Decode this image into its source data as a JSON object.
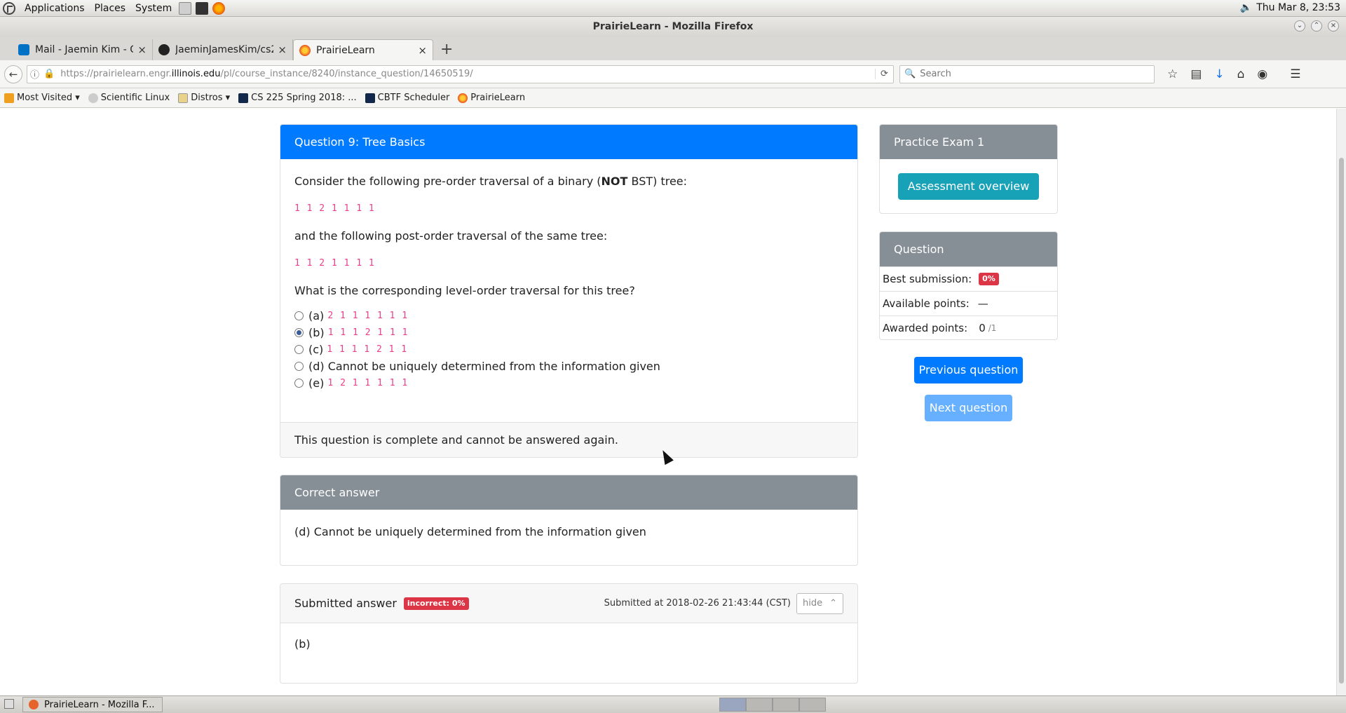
{
  "desktop": {
    "menus": [
      "Applications",
      "Places",
      "System"
    ],
    "clock": "Thu Mar  8, 23:53"
  },
  "window": {
    "title": "PrairieLearn - Mozilla Firefox"
  },
  "tabs": [
    {
      "label": "Mail - Jaemin Kim - O..."
    },
    {
      "label": "JaeminJamesKim/cs2..."
    },
    {
      "label": "PrairieLearn"
    }
  ],
  "url": {
    "prefix": "https://prairielearn.engr.",
    "domain": "illinois.edu",
    "path": "/pl/course_instance/8240/instance_question/14650519/"
  },
  "search": {
    "placeholder": "Search"
  },
  "bookmarks": [
    {
      "label": "Most Visited ▾"
    },
    {
      "label": "Scientific Linux"
    },
    {
      "label": "Distros ▾"
    },
    {
      "label": "CS 225 Spring 2018: ..."
    },
    {
      "label": "CBTF Scheduler"
    },
    {
      "label": "PrairieLearn"
    }
  ],
  "question": {
    "header": "Question 9: Tree Basics",
    "prompt_pre": "Consider the following pre-order traversal of a binary (",
    "prompt_bold": "NOT",
    "prompt_post": " BST) tree:",
    "preorder": "1 1 2 1 1 1 1",
    "prompt2": "and the following post-order traversal of the same tree:",
    "postorder": "1 1 2 1 1 1 1",
    "prompt3": "What is the corresponding level-order traversal for this tree?",
    "options": [
      {
        "key": "(a)",
        "text": "2 1 1 1 1 1 1",
        "code": true,
        "selected": false
      },
      {
        "key": "(b)",
        "text": "1 1 1 2 1 1 1",
        "code": true,
        "selected": true
      },
      {
        "key": "(c)",
        "text": "1 1 1 1 2 1 1",
        "code": true,
        "selected": false
      },
      {
        "key": "(d)",
        "text": "Cannot be uniquely determined from the information given",
        "code": false,
        "selected": false
      },
      {
        "key": "(e)",
        "text": "1 2 1 1 1 1 1",
        "code": true,
        "selected": false
      }
    ],
    "footer": "This question is complete and cannot be answered again."
  },
  "correct_answer": {
    "header": "Correct answer",
    "text": "(d) Cannot be uniquely determined from the information given"
  },
  "submitted": {
    "header": "Submitted answer",
    "badge": "incorrect: 0%",
    "submitted_at": "Submitted at 2018-02-26 21:43:44 (CST)",
    "hide_label": "hide",
    "answer": "(b)"
  },
  "sidebar": {
    "exam_title": "Practice Exam 1",
    "assessment_button": "Assessment overview",
    "question_header": "Question",
    "best_label": "Best submission:",
    "best_badge": "0%",
    "available_label": "Available points:",
    "available_value": "—",
    "awarded_label": "Awarded points:",
    "awarded_value": "0",
    "awarded_max": "/1",
    "prev_button": "Previous question",
    "next_button": "Next question"
  },
  "taskbar": {
    "item": "PrairieLearn - Mozilla F..."
  },
  "colors": {
    "primary": "#007bff",
    "info": "#17a2b8",
    "secondary": "#868e96",
    "danger": "#dc3545",
    "code": "#e83e8c"
  }
}
